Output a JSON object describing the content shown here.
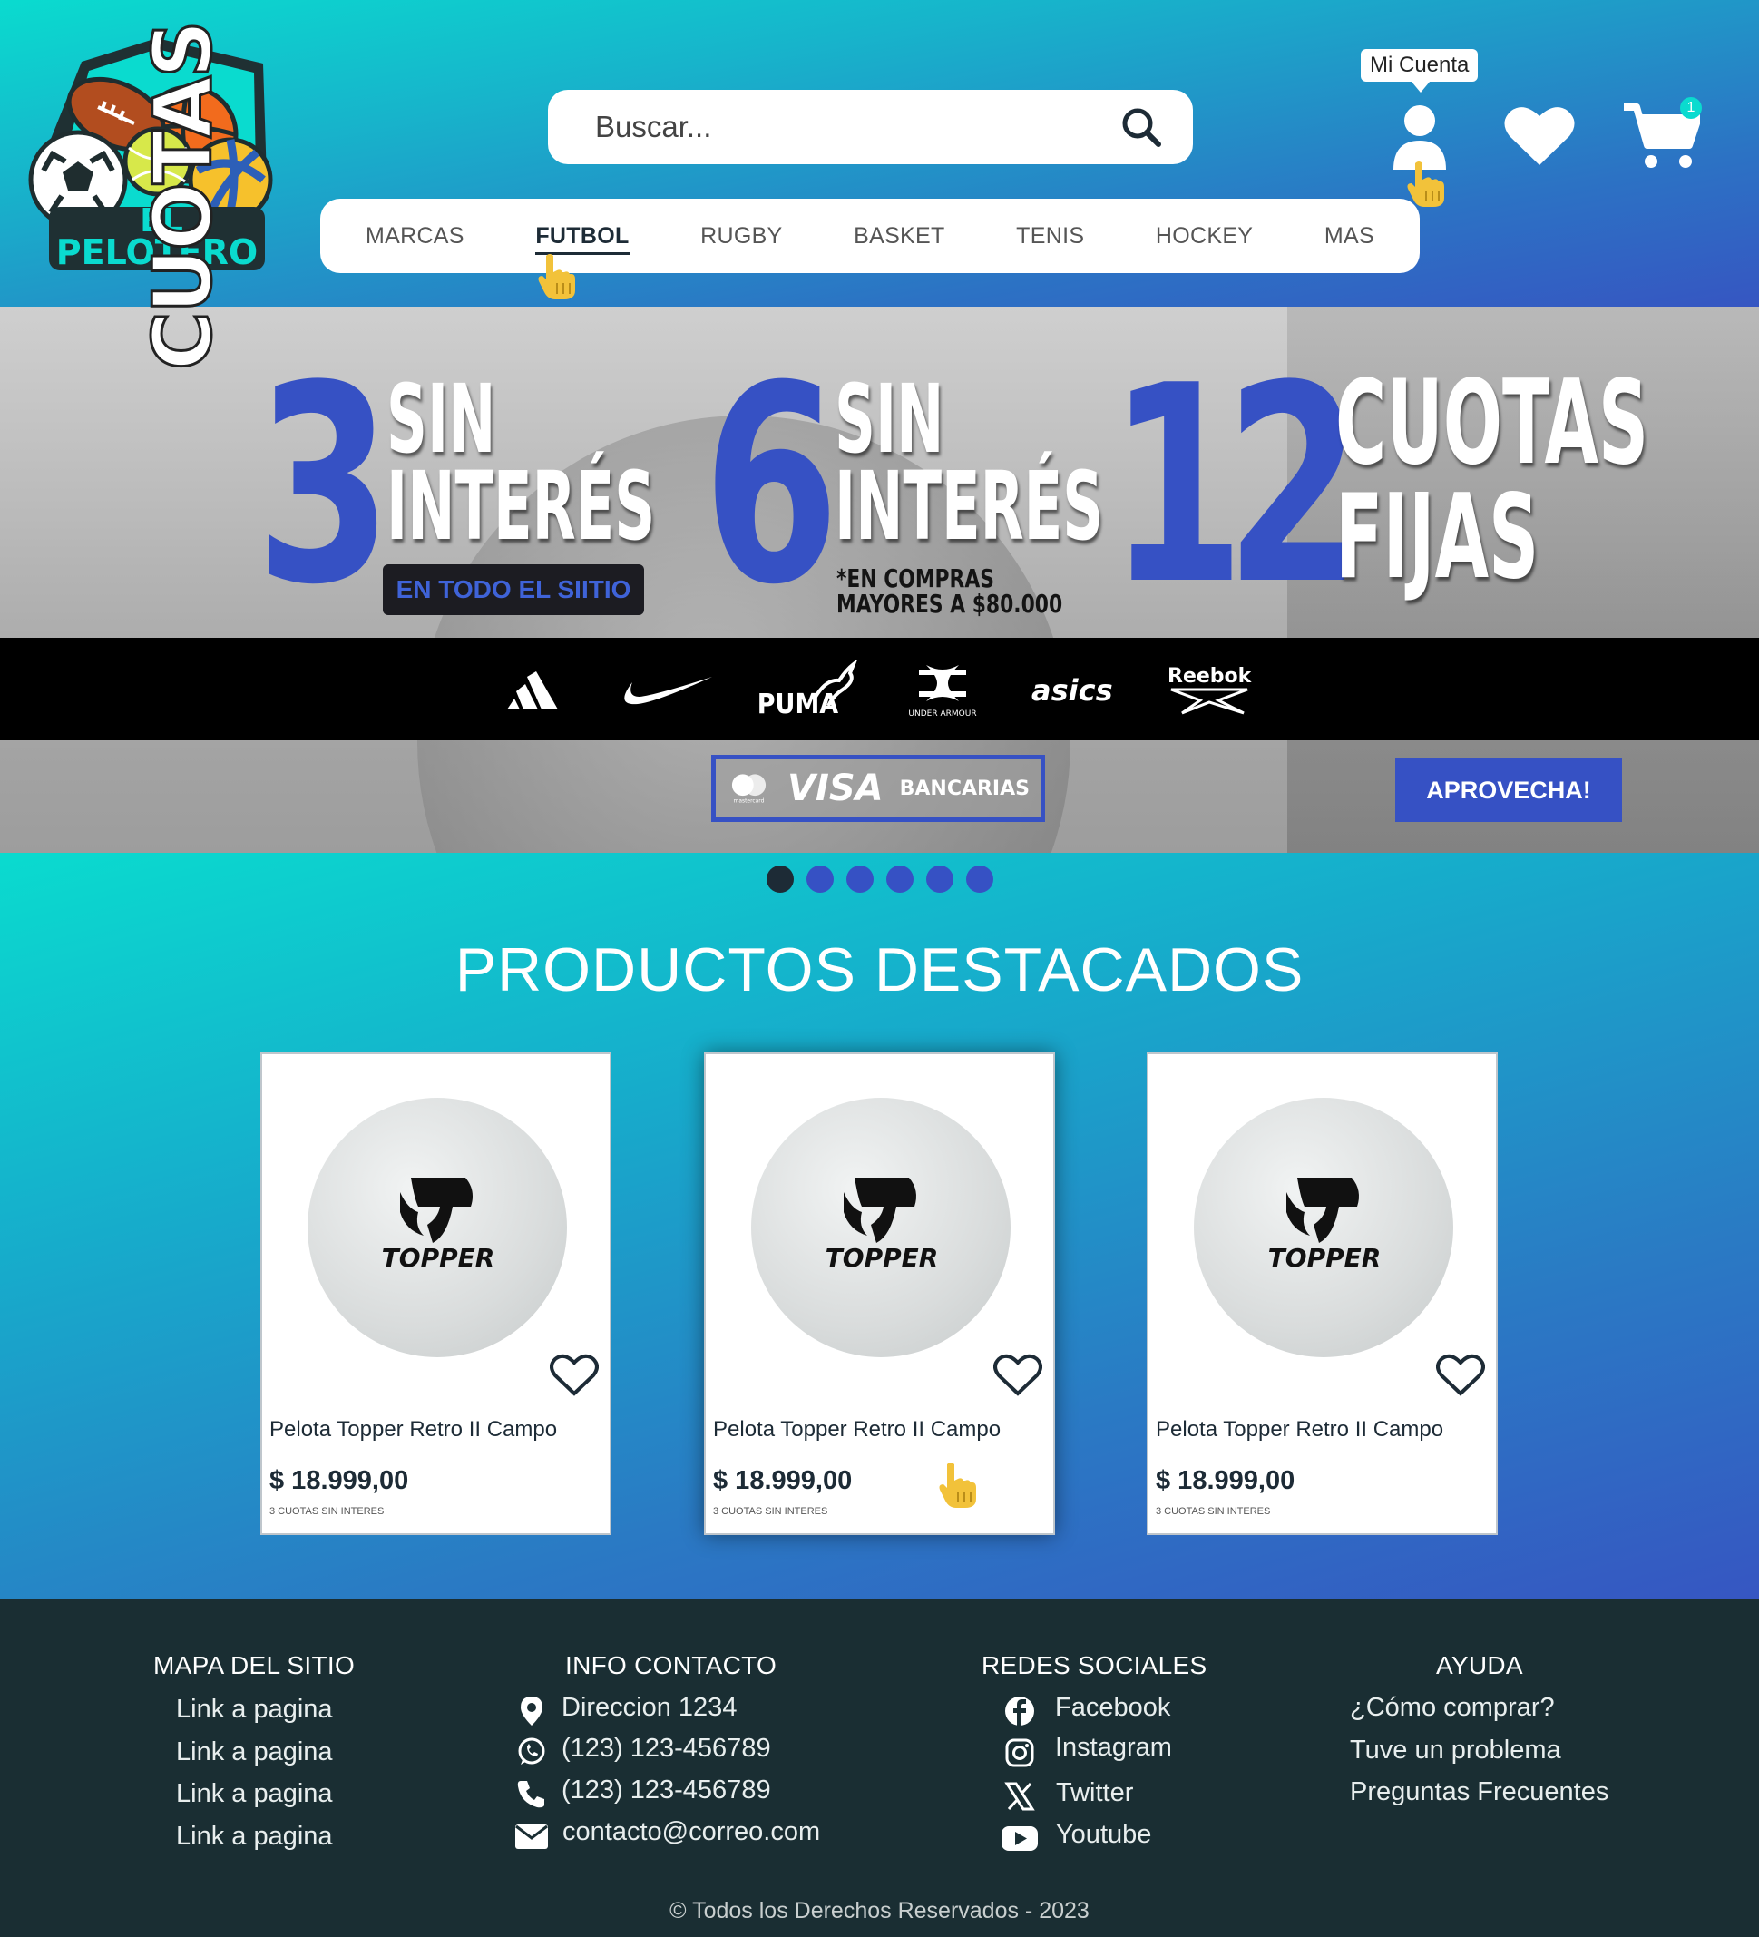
{
  "brand": {
    "logo_line1": "EL",
    "logo_line2": "PELOTERO"
  },
  "search": {
    "placeholder": "Buscar..."
  },
  "nav": {
    "items": [
      "MARCAS",
      "FUTBOL",
      "RUGBY",
      "BASKET",
      "TENIS",
      "HOCKEY",
      "MAS"
    ],
    "active": "FUTBOL"
  },
  "account": {
    "tooltip": "Mi Cuenta",
    "cart_count": "1"
  },
  "banner": {
    "cuotas_vertical": "CUOTAS",
    "offer1_number": "3",
    "offer1_line1": "SIN",
    "offer1_line2": "INTERÉS",
    "offer1_badge": "EN TODO EL SIITIO",
    "offer2_number": "6",
    "offer2_line1": "SIN",
    "offer2_line2": "INTERÉS",
    "offer2_note_line1": "*EN COMPRAS",
    "offer2_note_line2": "MAYORES A $80.000",
    "offer3_number": "12",
    "offer3_line1": "CUOTAS",
    "offer3_line2": "FIJAS",
    "brands": [
      "adidas",
      "nike",
      "PUMA",
      "UNDER ARMOUR",
      "asics",
      "Reebok"
    ],
    "mastercard_label": "mastercard",
    "visa_label": "VISA",
    "bancarias_label": "BANCARIAS",
    "cta_label": "APROVECHA!"
  },
  "carousel": {
    "dot_count": 6,
    "active_index": 0
  },
  "featured": {
    "title": "PRODUCTOS DESTACADOS",
    "products": [
      {
        "name": "Pelota Topper Retro II Campo",
        "price": "$ 18.999,00",
        "installments": "3 CUOTAS SIN INTERES",
        "brand": "TOPPER"
      },
      {
        "name": "Pelota Topper Retro II Campo",
        "price": "$ 18.999,00",
        "installments": "3 CUOTAS SIN INTERES",
        "brand": "TOPPER"
      },
      {
        "name": "Pelota Topper Retro II Campo",
        "price": "$ 18.999,00",
        "installments": "3 CUOTAS SIN INTERES",
        "brand": "TOPPER"
      }
    ]
  },
  "footer": {
    "sitemap": {
      "heading": "MAPA DEL SITIO",
      "links": [
        "Link a pagina",
        "Link a pagina",
        "Link a pagina",
        "Link a pagina"
      ]
    },
    "contact": {
      "heading": "INFO CONTACTO",
      "address": "Direccion 1234",
      "whatsapp": "(123) 123-456789",
      "phone": "(123) 123-456789",
      "email": "contacto@correo.com"
    },
    "social": {
      "heading": "REDES SOCIALES",
      "links": [
        "Facebook",
        "Instagram",
        "Twitter",
        "Youtube"
      ]
    },
    "help": {
      "heading": "AYUDA",
      "links": [
        "¿Cómo comprar?",
        "Tuve un problema",
        "Preguntas Frecuentes"
      ]
    },
    "copyright": "© Todos los Derechos Reservados - 2023"
  },
  "colors": {
    "accent_blue": "#3651c4",
    "teal": "#0adbcf",
    "footer_bg": "#1a2e33",
    "cursor_yellow": "#f2c23a"
  }
}
